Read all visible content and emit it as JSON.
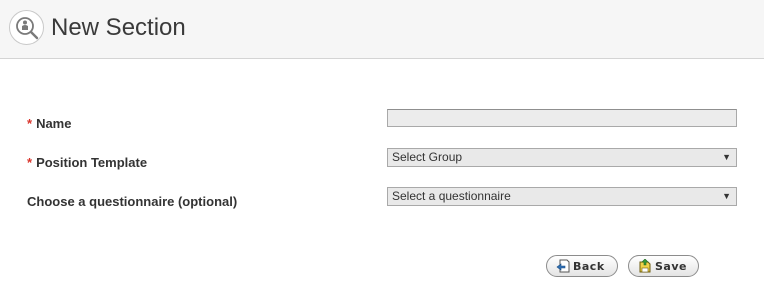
{
  "header": {
    "title": "New Section",
    "icon": "person-search-icon"
  },
  "form": {
    "name": {
      "label": "Name",
      "required_mark": "*",
      "value": ""
    },
    "position_template": {
      "label": "Position Template",
      "required_mark": "*",
      "selected": "Select Group"
    },
    "questionnaire": {
      "label": "Choose a questionnaire (optional)",
      "selected": "Select a questionnaire"
    }
  },
  "buttons": {
    "back": {
      "label": "Back",
      "icon": "back-page-icon"
    },
    "save": {
      "label": "Save",
      "icon": "save-icon"
    }
  },
  "colors": {
    "required": "#d9342b",
    "header_bg": "#f6f6f6",
    "input_bg": "#e9e9e9"
  }
}
